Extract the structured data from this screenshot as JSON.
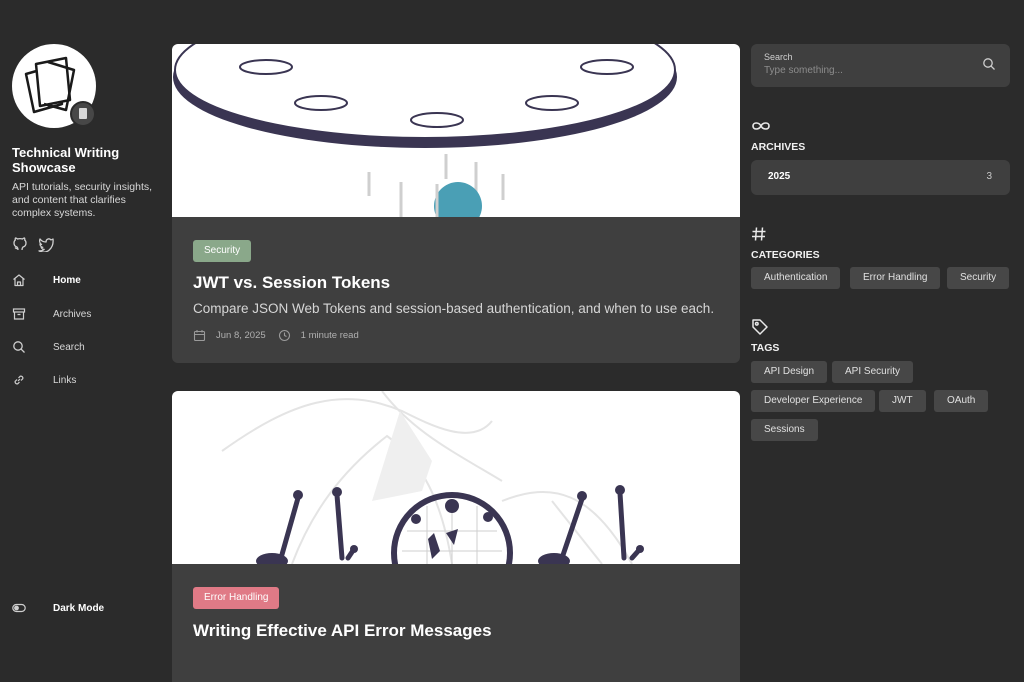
{
  "site": {
    "title": "Technical Writing Showcase",
    "description": "API tutorials, security insights, and content that clarifies complex systems."
  },
  "social": [
    {
      "icon": "github-icon"
    },
    {
      "icon": "twitter-icon"
    }
  ],
  "nav": [
    {
      "label": "Home",
      "icon": "home-icon",
      "active": true
    },
    {
      "label": "Archives",
      "icon": "archive-icon",
      "active": false
    },
    {
      "label": "Search",
      "icon": "search-icon",
      "active": false
    },
    {
      "label": "Links",
      "icon": "link-icon",
      "active": false
    }
  ],
  "dark_mode": {
    "label": "Dark Mode",
    "icon": "toggle-icon"
  },
  "posts": [
    {
      "tag": "Security",
      "tag_color": "#8aa88a",
      "title": "JWT vs. Session Tokens",
      "description": "Compare JSON Web Tokens and session-based authentication, and when to use each.",
      "date": "Jun 8, 2025",
      "read_time": "1 minute read"
    },
    {
      "tag": "Error Handling",
      "tag_color": "#e07a86",
      "title": "Writing Effective API Error Messages"
    }
  ],
  "search": {
    "label": "Search",
    "placeholder": "Type something..."
  },
  "archives": {
    "heading": "ARCHIVES",
    "items": [
      {
        "year": "2025",
        "count": "3"
      }
    ]
  },
  "categories": {
    "heading": "CATEGORIES",
    "items": [
      "Authentication",
      "Error Handling",
      "Security"
    ]
  },
  "tags": {
    "heading": "TAGS",
    "items": [
      "API Design",
      "API Security",
      "Developer Experience",
      "JWT",
      "OAuth",
      "Sessions"
    ]
  }
}
